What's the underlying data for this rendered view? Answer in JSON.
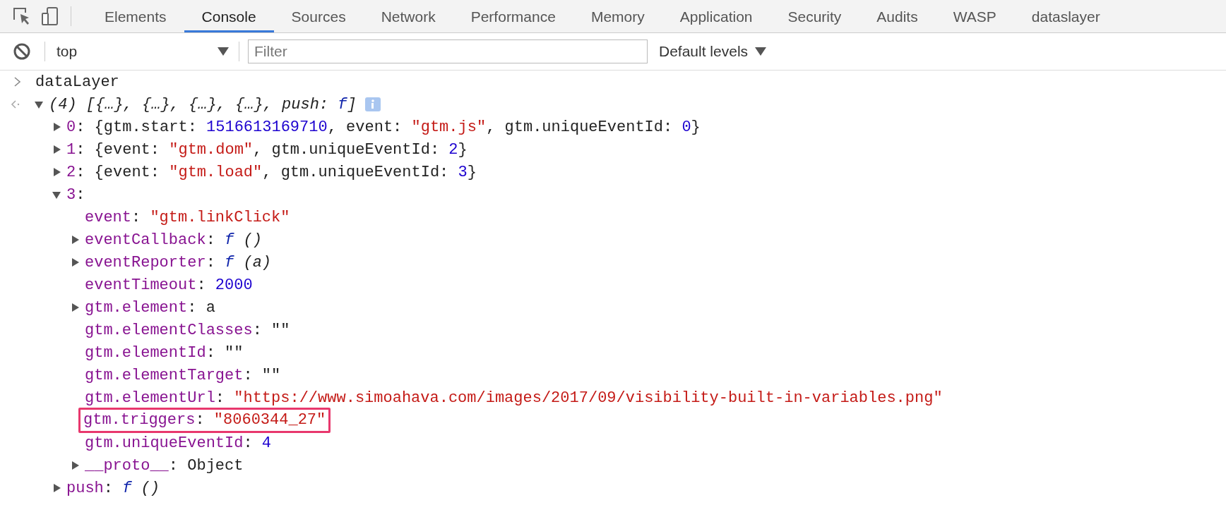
{
  "tabs": [
    {
      "label": "Elements",
      "selected": false
    },
    {
      "label": "Console",
      "selected": true
    },
    {
      "label": "Sources",
      "selected": false
    },
    {
      "label": "Network",
      "selected": false
    },
    {
      "label": "Performance",
      "selected": false
    },
    {
      "label": "Memory",
      "selected": false
    },
    {
      "label": "Application",
      "selected": false
    },
    {
      "label": "Security",
      "selected": false
    },
    {
      "label": "Audits",
      "selected": false
    },
    {
      "label": "WASP",
      "selected": false
    },
    {
      "label": "dataslayer",
      "selected": false
    }
  ],
  "toolbar": {
    "context": "top",
    "filter": {
      "placeholder": "Filter"
    },
    "levels": "Default levels"
  },
  "console": {
    "input": "dataLayer",
    "output": {
      "expanded": true,
      "info_badge": true,
      "tokens": [
        {
          "kind": "italic",
          "text": "(4) [{…}, {…}, {…}, {…}, push: "
        },
        {
          "kind": "func",
          "text": "f"
        },
        {
          "kind": "italic",
          "text": "]"
        }
      ],
      "children": [
        {
          "expanded": false,
          "tokens": [
            {
              "kind": "key",
              "text": "0"
            },
            {
              "kind": "plain",
              "text": ": {gtm.start: "
            },
            {
              "kind": "number",
              "text": "1516613169710"
            },
            {
              "kind": "plain",
              "text": ", event: "
            },
            {
              "kind": "string",
              "text": "\"gtm.js\""
            },
            {
              "kind": "plain",
              "text": ", gtm.uniqueEventId: "
            },
            {
              "kind": "number",
              "text": "0"
            },
            {
              "kind": "plain",
              "text": "}"
            }
          ]
        },
        {
          "expanded": false,
          "tokens": [
            {
              "kind": "key",
              "text": "1"
            },
            {
              "kind": "plain",
              "text": ": {event: "
            },
            {
              "kind": "string",
              "text": "\"gtm.dom\""
            },
            {
              "kind": "plain",
              "text": ", gtm.uniqueEventId: "
            },
            {
              "kind": "number",
              "text": "2"
            },
            {
              "kind": "plain",
              "text": "}"
            }
          ]
        },
        {
          "expanded": false,
          "tokens": [
            {
              "kind": "key",
              "text": "2"
            },
            {
              "kind": "plain",
              "text": ": {event: "
            },
            {
              "kind": "string",
              "text": "\"gtm.load\""
            },
            {
              "kind": "plain",
              "text": ", gtm.uniqueEventId: "
            },
            {
              "kind": "number",
              "text": "3"
            },
            {
              "kind": "plain",
              "text": "}"
            }
          ]
        },
        {
          "expanded": true,
          "tokens": [
            {
              "kind": "key",
              "text": "3"
            },
            {
              "kind": "plain",
              "text": ":"
            }
          ],
          "children": [
            {
              "tokens": [
                {
                  "kind": "key",
                  "text": "event"
                },
                {
                  "kind": "plain",
                  "text": ": "
                },
                {
                  "kind": "string",
                  "text": "\"gtm.linkClick\""
                }
              ]
            },
            {
              "expanded": false,
              "tokens": [
                {
                  "kind": "key",
                  "text": "eventCallback"
                },
                {
                  "kind": "plain",
                  "text": ": "
                },
                {
                  "kind": "func",
                  "text": "f"
                },
                {
                  "kind": "italic",
                  "text": " ()"
                }
              ]
            },
            {
              "expanded": false,
              "tokens": [
                {
                  "kind": "key",
                  "text": "eventReporter"
                },
                {
                  "kind": "plain",
                  "text": ": "
                },
                {
                  "kind": "func",
                  "text": "f"
                },
                {
                  "kind": "italic",
                  "text": " (a)"
                }
              ]
            },
            {
              "tokens": [
                {
                  "kind": "key",
                  "text": "eventTimeout"
                },
                {
                  "kind": "plain",
                  "text": ": "
                },
                {
                  "kind": "number",
                  "text": "2000"
                }
              ]
            },
            {
              "expanded": false,
              "tokens": [
                {
                  "kind": "key",
                  "text": "gtm.element"
                },
                {
                  "kind": "plain",
                  "text": ": a"
                }
              ]
            },
            {
              "tokens": [
                {
                  "kind": "key",
                  "text": "gtm.elementClasses"
                },
                {
                  "kind": "plain",
                  "text": ": \"\""
                }
              ]
            },
            {
              "tokens": [
                {
                  "kind": "key",
                  "text": "gtm.elementId"
                },
                {
                  "kind": "plain",
                  "text": ": \"\""
                }
              ]
            },
            {
              "tokens": [
                {
                  "kind": "key",
                  "text": "gtm.elementTarget"
                },
                {
                  "kind": "plain",
                  "text": ": \"\""
                }
              ]
            },
            {
              "tokens": [
                {
                  "kind": "key",
                  "text": "gtm.elementUrl"
                },
                {
                  "kind": "plain",
                  "text": ": "
                },
                {
                  "kind": "string",
                  "text": "\"https://www.simoahava.com/images/2017/09/visibility-built-in-variables.png\""
                }
              ]
            },
            {
              "highlighted": true,
              "tokens": [
                {
                  "kind": "key",
                  "text": "gtm.triggers"
                },
                {
                  "kind": "plain",
                  "text": ": "
                },
                {
                  "kind": "string",
                  "text": "\"8060344_27\""
                }
              ]
            },
            {
              "tokens": [
                {
                  "kind": "key",
                  "text": "gtm.uniqueEventId"
                },
                {
                  "kind": "plain",
                  "text": ": "
                },
                {
                  "kind": "number",
                  "text": "4"
                }
              ]
            },
            {
              "expanded": false,
              "tokens": [
                {
                  "kind": "key",
                  "text": "__proto__"
                },
                {
                  "kind": "plain",
                  "text": ": Object"
                }
              ]
            }
          ]
        },
        {
          "expanded": false,
          "tokens": [
            {
              "kind": "key",
              "text": "push"
            },
            {
              "kind": "plain",
              "text": ": "
            },
            {
              "kind": "func",
              "text": "f"
            },
            {
              "kind": "italic",
              "text": " ()"
            }
          ]
        }
      ]
    }
  }
}
